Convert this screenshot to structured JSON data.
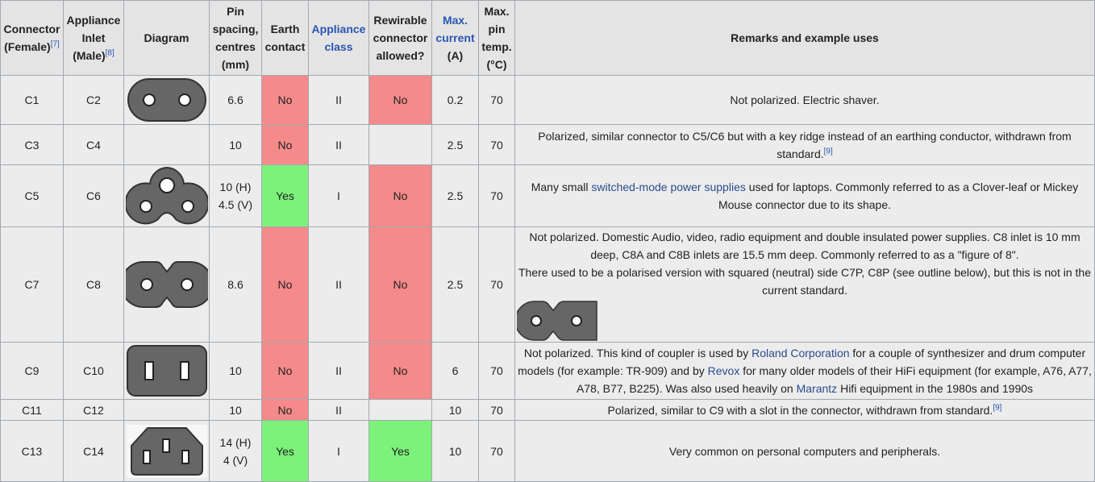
{
  "headers": {
    "connector": "Connector (Female)",
    "connector_ref": "[7]",
    "inlet": "Appliance Inlet (Male)",
    "inlet_ref": "[8]",
    "diagram": "Diagram",
    "pin_spacing": "Pin spacing, centres (mm)",
    "earth": "Earth contact",
    "appliance_class": "Appliance class",
    "rewirable": "Rewirable connector allowed?",
    "max_current_link": "Max. current",
    "max_current_unit": "(A)",
    "max_temp": "Max. pin temp. (°C)",
    "remarks": "Remarks and example uses"
  },
  "colors": {
    "no": "#f58a8a",
    "yes": "#7cf27a",
    "link": "#2a4b8d",
    "connector_fill": "#666666"
  },
  "rows": [
    {
      "connector": "C1",
      "inlet": "C2",
      "diagram": "oval-two-pin-icon",
      "pin_spacing_1": "6.6",
      "pin_spacing_2": "",
      "earth": "No",
      "class": "II",
      "rewirable": "No",
      "current": "0.2",
      "temp": "70",
      "remarks": {
        "t1": "Not polarized. Electric shaver."
      }
    },
    {
      "connector": "C3",
      "inlet": "C4",
      "diagram": "",
      "pin_spacing_1": "10",
      "pin_spacing_2": "",
      "earth": "No",
      "class": "II",
      "rewirable": "",
      "current": "2.5",
      "temp": "70",
      "remarks": {
        "t1": "Polarized, similar connector to C5/C6 but with a key ridge instead of an earthing conductor, withdrawn from standard.",
        "ref": "[9]"
      }
    },
    {
      "connector": "C5",
      "inlet": "C6",
      "diagram": "cloverleaf-icon",
      "pin_spacing_1": "10 (H)",
      "pin_spacing_2": "4.5 (V)",
      "earth": "Yes",
      "class": "I",
      "rewirable": "No",
      "current": "2.5",
      "temp": "70",
      "remarks": {
        "t1": "Many small ",
        "link1": "switched-mode power supplies",
        "t2": " used for laptops. Commonly referred to as a Clover-leaf or Mickey Mouse connector due to its shape."
      }
    },
    {
      "connector": "C7",
      "inlet": "C8",
      "diagram": "figure-8-icon",
      "pin_spacing_1": "8.6",
      "pin_spacing_2": "",
      "earth": "No",
      "class": "II",
      "rewirable": "No",
      "current": "2.5",
      "temp": "70",
      "remarks": {
        "t1": "Not polarized. Domestic Audio, video, radio equipment and double insulated power supplies. C8 inlet is 10 mm deep, C8A and C8B inlets are 15.5 mm deep. Commonly referred to as a \"figure of 8\".",
        "t2": "There used to be a polarised version with squared (neutral) side C7P, C8P (see outline below), but this is not in the current standard."
      }
    },
    {
      "connector": "C9",
      "inlet": "C10",
      "diagram": "rectangular-two-slot-icon",
      "pin_spacing_1": "10",
      "pin_spacing_2": "",
      "earth": "No",
      "class": "II",
      "rewirable": "No",
      "current": "6",
      "temp": "70",
      "remarks": {
        "t1": "Not polarized. This kind of coupler is used by ",
        "link1": "Roland Corporation",
        "t2": " for a couple of synthesizer and drum computer models (for example: TR-909) and by ",
        "link2": "Revox",
        "t3": " for many older models of their HiFi equipment (for example, A76, A77, A78, B77, B225). Was also used heavily on ",
        "link3": "Marantz",
        "t4": " Hifi equipment in the 1980s and 1990s"
      }
    },
    {
      "connector": "C11",
      "inlet": "C12",
      "diagram": "",
      "pin_spacing_1": "10",
      "pin_spacing_2": "",
      "earth": "No",
      "class": "II",
      "rewirable": "",
      "current": "10",
      "temp": "70",
      "remarks": {
        "t1": "Polarized, similar to C9 with a slot in the connector, withdrawn from standard.",
        "ref": "[9]"
      }
    },
    {
      "connector": "C13",
      "inlet": "C14",
      "diagram": "kettle-plug-icon",
      "pin_spacing_1": "14 (H)",
      "pin_spacing_2": "4 (V)",
      "earth": "Yes",
      "class": "I",
      "rewirable": "Yes",
      "current": "10",
      "temp": "70",
      "remarks": {
        "t1": "Very common on personal computers and peripherals."
      }
    }
  ]
}
